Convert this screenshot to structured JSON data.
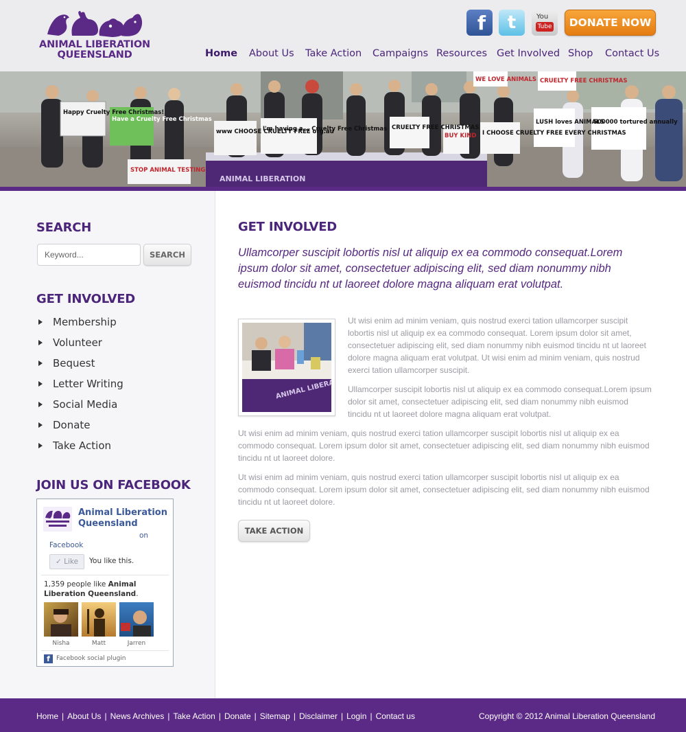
{
  "header": {
    "logo": {
      "line1": "ANIMAL LIBERATION",
      "line2": "QUEENSLAND",
      "icon": "animal-silhouettes-logo"
    },
    "social": [
      {
        "name": "facebook",
        "icon": "facebook-icon",
        "glyph": "f"
      },
      {
        "name": "twitter",
        "icon": "twitter-icon",
        "glyph": "t"
      },
      {
        "name": "youtube",
        "icon": "youtube-icon",
        "top": "You",
        "box": "Tube"
      }
    ],
    "donate_label": "DONATE NOW",
    "nav": [
      "Home",
      "About Us",
      "Take Action",
      "Campaigns",
      "Resources",
      "Get Involved",
      "Shop",
      "Contact Us"
    ],
    "active_nav": "Home"
  },
  "hero": {
    "signs": [
      "Happy Cruelty Free Christmas!",
      "Have a Cruelty Free Christmas",
      "STOP ANIMAL TESTING",
      "www CHOOSE CRUELTY FREE org.au",
      "I'm having a... Cruelty Free Christmas",
      "CRUELTY FREE CHRISTMAS",
      "BUY KIND",
      "I CHOOSE CRUELTY FREE EVERY CHRISTMAS",
      "LUSH loves ANIMALS",
      "500000 tortured annually",
      "WE LOVE ANIMALS",
      "CRUELTY FREE CHRISTMAS",
      "ANIMAL LIBERATION"
    ]
  },
  "sidebar": {
    "search_title": "SEARCH",
    "search_placeholder": "Keyword...",
    "search_button": "SEARCH",
    "get_involved_title": "GET INVOLVED",
    "get_involved_items": [
      "Membership",
      "Volunteer",
      "Bequest",
      "Letter Writing",
      "Social Media",
      "Donate",
      "Take Action"
    ],
    "facebook_title": "JOIN US ON FACEBOOK",
    "facebook": {
      "page_name": "Animal Liberation Queensland",
      "on": "on",
      "facebook": "Facebook",
      "like_button": "Like",
      "you_like": "You like this.",
      "count_prefix": "1,359 people like ",
      "count_name": "Animal Liberation Queensland",
      "count_suffix": ".",
      "faces": [
        "Nisha",
        "Matt",
        "Jarren"
      ],
      "plugin": "Facebook social plugin"
    }
  },
  "content": {
    "title": "GET INVOLVED",
    "lead": "Ullamcorper suscipit lobortis nisl ut aliquip ex ea commodo consequat.Lorem ipsum dolor sit amet, consectetuer adipiscing elit, sed diam nonummy nibh euismod tincidu nt ut laoreet dolore magna aliquam erat volutpat.",
    "photo_caption": "ANIMAL LIBERATION",
    "paragraphs": [
      "Ut wisi enim ad minim veniam, quis nostrud exerci tation ullamcorper suscipit lobortis nisl ut aliquip ex ea commodo consequat. Lorem ipsum dolor sit amet, consectetuer adipiscing elit, sed diam nonummy nibh euismod tincidu nt ut laoreet dolore magna aliquam erat volutpat. Ut wisi enim ad minim veniam, quis nostrud exerci tation ullamcorper suscipit.",
      "Ullamcorper suscipit lobortis nisl ut aliquip ex ea commodo consequat.Lorem ipsum dolor sit amet, consectetuer adipiscing elit, sed diam nonummy nibh euismod tincidu nt ut laoreet dolore magna aliquam erat volutpat.",
      "Ut wisi enim ad minim veniam, quis nostrud exerci tation ullamcorper suscipit lobortis nisl ut aliquip ex ea commodo consequat. Lorem ipsum dolor sit amet, consectetuer adipiscing elit, sed diam nonummy nibh euismod tincidu nt ut laoreet dolore.",
      "Ut wisi enim ad minim veniam, quis nostrud exerci tation ullamcorper suscipit lobortis nisl ut aliquip ex ea commodo consequat. Lorem ipsum dolor sit amet, consectetuer adipiscing elit, sed diam nonummy nibh euismod tincidu nt ut laoreet dolore."
    ],
    "button": "TAKE ACTION"
  },
  "footer": {
    "links": [
      "Home",
      "About Us",
      "News Archives",
      "Take Action",
      "Donate",
      "Sitemap",
      "Disclaimer",
      "Login",
      "Contact us"
    ],
    "separator": "|",
    "copyright": "Copyright © 2012 Animal Liberation Queensland"
  },
  "colors": {
    "brand_purple": "#5b2a86",
    "donate_orange": "#e98a1c",
    "nav_text": "#4b2579",
    "body_text": "#9a9aa2",
    "facebook_blue": "#3b5998"
  }
}
